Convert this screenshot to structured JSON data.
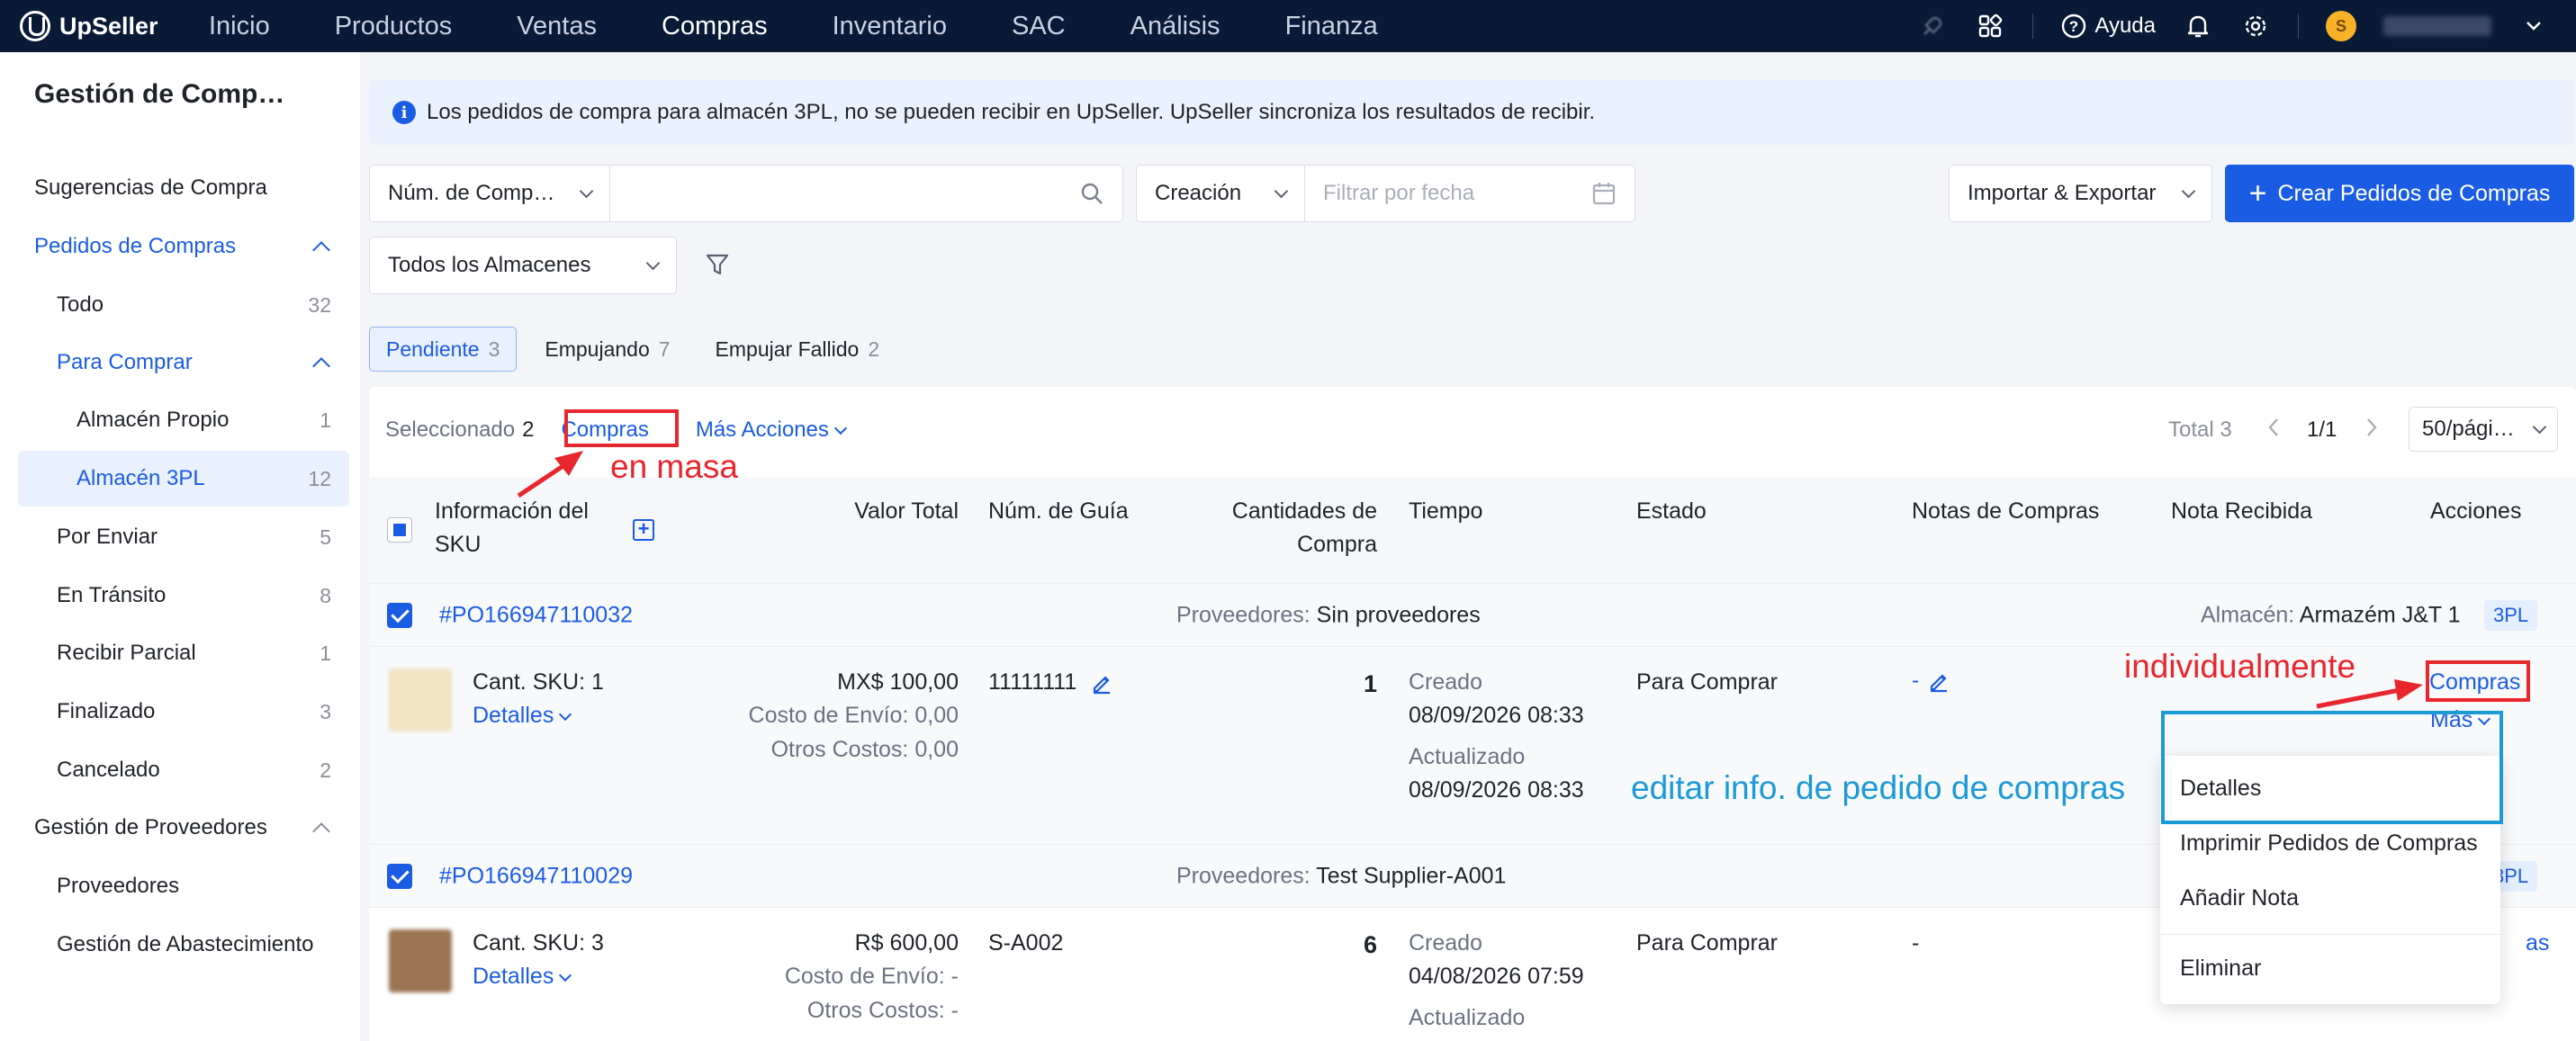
{
  "app": {
    "logo_text": "UpSeller"
  },
  "nav": {
    "items": [
      {
        "label": "Inicio"
      },
      {
        "label": "Productos"
      },
      {
        "label": "Ventas"
      },
      {
        "label": "Compras",
        "active": true
      },
      {
        "label": "Inventario"
      },
      {
        "label": "SAC"
      },
      {
        "label": "Análisis"
      },
      {
        "label": "Finanza"
      }
    ],
    "help_label": "Ayuda",
    "avatar_letter": "S"
  },
  "sidebar": {
    "title": "Gestión de Comp…",
    "items": [
      {
        "label": "Sugerencias de Compra",
        "count": ""
      },
      {
        "label": "Pedidos de Compras",
        "count": ""
      },
      {
        "label": "Todo",
        "count": "32"
      },
      {
        "label": "Para Comprar",
        "count": ""
      },
      {
        "label": "Almacén Propio",
        "count": "1"
      },
      {
        "label": "Almacén 3PL",
        "count": "12"
      },
      {
        "label": "Por Enviar",
        "count": "5"
      },
      {
        "label": "En Tránsito",
        "count": "8"
      },
      {
        "label": "Recibir Parcial",
        "count": "1"
      },
      {
        "label": "Finalizado",
        "count": "3"
      },
      {
        "label": "Cancelado",
        "count": "2"
      },
      {
        "label": "Gestión de Proveedores",
        "count": ""
      },
      {
        "label": "Proveedores",
        "count": ""
      },
      {
        "label": "Gestión de Abastecimiento",
        "count": ""
      }
    ]
  },
  "banner": {
    "text": "Los pedidos de compra para almacén 3PL, no se pueden recibir en UpSeller. UpSeller sincroniza los resultados de recibir."
  },
  "filters": {
    "search_type": "Núm. de Comp…",
    "search_value": "",
    "date_type": "Creación",
    "date_placeholder": "Filtrar por fecha",
    "warehouse": "Todos los Almacenes",
    "import_export": "Importar & Exportar",
    "create_button": "Crear Pedidos de Compras"
  },
  "tabs": [
    {
      "label": "Pendiente",
      "count": "3",
      "active": true
    },
    {
      "label": "Empujando",
      "count": "7"
    },
    {
      "label": "Empujar Fallido",
      "count": "2"
    }
  ],
  "toolbar": {
    "selected_label": "Seleccionado",
    "selected_count": "2",
    "bulk_purchase": "Compras",
    "more_actions": "Más Acciones",
    "total": "Total 3",
    "page": "1/1",
    "page_size": "50/pági…"
  },
  "table": {
    "headers": {
      "sku": "Información del SKU",
      "total": "Valor Total",
      "guide": "Núm. de Guía",
      "qty": "Cantidades de Compra",
      "time": "Tiempo",
      "status": "Estado",
      "notes": "Notas de Compras",
      "received": "Nota Recibida",
      "actions": "Acciones"
    },
    "orders": [
      {
        "id": "#PO166947110032",
        "supplier_label": "Proveedores:",
        "supplier": "Sin proveedores",
        "warehouse_label": "Almacén:",
        "warehouse": "Armazém J&T 1",
        "tag": "3PL",
        "sku_count": "Cant. SKU: 1",
        "details": "Detalles",
        "total": "MX$ 100,00",
        "shipping": "Costo de Envío: 0,00",
        "other": "Otros Costos: 0,00",
        "guide": "11111111",
        "qty": "1",
        "created_label": "Creado",
        "created": "08/09/2026 08:33",
        "updated_label": "Actualizado",
        "updated": "08/09/2026 08:33",
        "status": "Para Comprar",
        "note": "-",
        "action_purchase": "Compras",
        "action_more": "Más"
      },
      {
        "id": "#PO166947110029",
        "supplier_label": "Proveedores:",
        "supplier": "Test Supplier-A001",
        "tag": "3PL",
        "sku_count": "Cant. SKU: 3",
        "details": "Detalles",
        "total": "R$ 600,00",
        "shipping": "Costo de Envío: -",
        "other": "Otros Costos: -",
        "guide": "S-A002",
        "qty": "6",
        "created_label": "Creado",
        "created": "04/08/2026 07:59",
        "updated_label": "Actualizado",
        "status": "Para Comprar",
        "note": "-",
        "action_purchase_partial": "as"
      }
    ]
  },
  "dropdown": {
    "items": [
      "Detalles",
      "Imprimir Pedidos de Compras",
      "Añadir Nota",
      "Eliminar"
    ]
  },
  "annotations": {
    "bulk": "en masa",
    "individual": "individualmente",
    "edit": "editar info. de pedido de compras"
  },
  "colors": {
    "nav_bg": "#081a36",
    "primary": "#1b5ce4",
    "annotation_red": "#e8262d",
    "annotation_blue": "#1b9ad6"
  }
}
